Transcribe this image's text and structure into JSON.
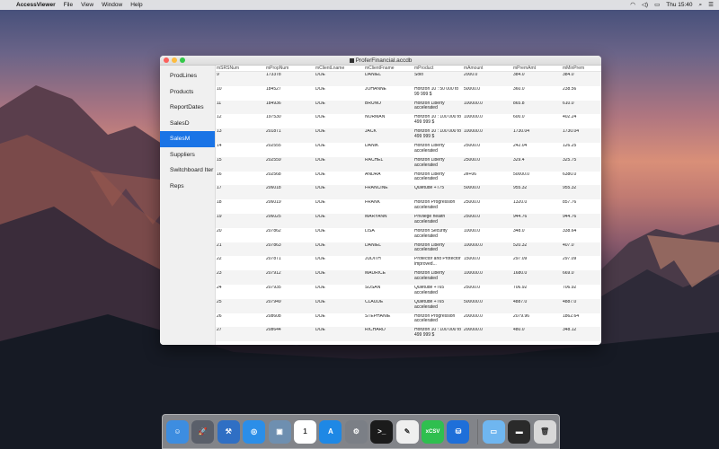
{
  "menubar": {
    "app_name": "AccessViewer",
    "items": [
      "File",
      "View",
      "Window",
      "Help"
    ],
    "clock": "Thu 15:40"
  },
  "window": {
    "title": "ProferFinancial.accdb"
  },
  "sidebar": {
    "items": [
      {
        "label": "ProdLines",
        "selected": false
      },
      {
        "label": "Products",
        "selected": false
      },
      {
        "label": "ReportDates",
        "selected": false
      },
      {
        "label": "SalesD",
        "selected": false
      },
      {
        "label": "SalesM",
        "selected": true
      },
      {
        "label": "Suppliers",
        "selected": false
      },
      {
        "label": "Switchboard Iter",
        "selected": false
      },
      {
        "label": "Reps",
        "selected": false
      }
    ]
  },
  "table": {
    "columns": [
      "mSRSNum",
      "mPropNum",
      "mClientLname",
      "mClientFname",
      "mProduct",
      "mAmount",
      "mPremAmt",
      "mMinPrem"
    ],
    "rows": [
      [
        "9",
        "173378",
        "DOE",
        "DANIEL",
        "Solo",
        "2000.0",
        "384.0",
        "384.0"
      ],
      [
        "10",
        "184527",
        "DOE",
        "JOHANNE",
        "Horizon 10 : 50 000 to 99 999 $",
        "50000.0",
        "360.0",
        "238.56"
      ],
      [
        "11",
        "184936",
        "DOE",
        "BRUNO",
        "Horizon Liberty accelerated",
        "100000.0",
        "865.8",
        "610.0"
      ],
      [
        "12",
        "197530",
        "DOE",
        "NORMAN",
        "Horizon 10 : 100 000 to 499 999 $",
        "100000.0",
        "600.0",
        "402.24"
      ],
      [
        "13",
        "201871",
        "DOE",
        "JACK",
        "Horizon 10 : 100 000 to 499 999 $",
        "100000.0",
        "1730.04",
        "1730.04"
      ],
      [
        "14",
        "202555",
        "DOE",
        "DANIK",
        "Horizon Liberty accelerated",
        "25000.0",
        "242.04",
        "126.25"
      ],
      [
        "15",
        "202559",
        "DOE",
        "RACHEL",
        "Horizon Liberty accelerated",
        "25000.0",
        "329.4",
        "325.75"
      ],
      [
        "16",
        "202568",
        "DOE",
        "ANDRÃ",
        "Horizon Liberty accelerated",
        "2e+06",
        "50000.0",
        "6380.0"
      ],
      [
        "17",
        "206018",
        "DOE",
        "FRANCINE",
        "Quietude +T75",
        "50000.0",
        "955.32",
        "955.32"
      ],
      [
        "18",
        "206019",
        "DOE",
        "FRANK",
        "Horizon Progression accelerated",
        "25000.0",
        "1320.0",
        "857.76"
      ],
      [
        "19",
        "206025",
        "DOE",
        "MARYANN",
        "Privilege health accelerated",
        "25000.0",
        "944.76",
        "944.76"
      ],
      [
        "20",
        "207862",
        "DOE",
        "LISA",
        "Horizon Security accelerated",
        "10000.0",
        "348.0",
        "338.64"
      ],
      [
        "21",
        "207863",
        "DOE",
        "DANIEL",
        "Horizon Liberty accelerated",
        "100000.0",
        "520.32",
        "407.0"
      ],
      [
        "22",
        "207871",
        "DOE",
        "JUDITH",
        "Protector and Protector improved...",
        "15000.0",
        "297.09",
        "297.09"
      ],
      [
        "23",
        "207912",
        "DOE",
        "MAURICE",
        "Horizon Liberty accelerated",
        "100000.0",
        "1680.0",
        "669.0"
      ],
      [
        "24",
        "207935",
        "DOE",
        "SUSAN",
        "Quietude +T65 accelerated",
        "25000.0",
        "706.92",
        "706.92"
      ],
      [
        "25",
        "207949",
        "DOE",
        "CLAUDE",
        "Quietude +T65 accelerated",
        "500000.0",
        "4887.0",
        "4887.0"
      ],
      [
        "26",
        "208608",
        "DOE",
        "STEPHANIE",
        "Horizon Progression accelerated",
        "200000.0",
        "2079.96",
        "1862.64"
      ],
      [
        "27",
        "208644",
        "DOE",
        "RICHARD",
        "Horizon 10 : 100 000 to 499 999 $",
        "200000.0",
        "480.0",
        "348.12"
      ]
    ]
  },
  "dock": {
    "icons": [
      {
        "name": "finder-icon",
        "color": "#3d8de0",
        "glyph": "☺"
      },
      {
        "name": "launchpad-icon",
        "color": "#5a5f6a",
        "glyph": "🚀"
      },
      {
        "name": "xcode-icon",
        "color": "#2f6fc4",
        "glyph": "⚒"
      },
      {
        "name": "safari-icon",
        "color": "#2b8ee8",
        "glyph": "◎"
      },
      {
        "name": "preview-icon",
        "color": "#6e8fb0",
        "glyph": "▣"
      },
      {
        "name": "calendar-icon",
        "color": "#ffffff",
        "glyph": "1"
      },
      {
        "name": "app-store-icon",
        "color": "#1e88e5",
        "glyph": "A"
      },
      {
        "name": "system-preferences-icon",
        "color": "#7b7f86",
        "glyph": "⚙"
      },
      {
        "name": "terminal-icon",
        "color": "#1b1b1b",
        "glyph": ">_"
      },
      {
        "name": "textedit-icon",
        "color": "#efefef",
        "glyph": "✎"
      },
      {
        "name": "xcsv-icon",
        "color": "#2fbf4f",
        "glyph": "xCSV"
      },
      {
        "name": "accessviewer-icon",
        "color": "#1e6fd9",
        "glyph": "⛁"
      }
    ],
    "right_icons": [
      {
        "name": "folder-icon",
        "color": "#6fb6f0",
        "glyph": "▭"
      },
      {
        "name": "screenshot-icon",
        "color": "#2a2a2a",
        "glyph": "▬"
      },
      {
        "name": "trash-icon",
        "color": "#d8d8d8",
        "glyph": "🗑"
      }
    ]
  },
  "colors": {
    "accent": "#1a74e6"
  }
}
